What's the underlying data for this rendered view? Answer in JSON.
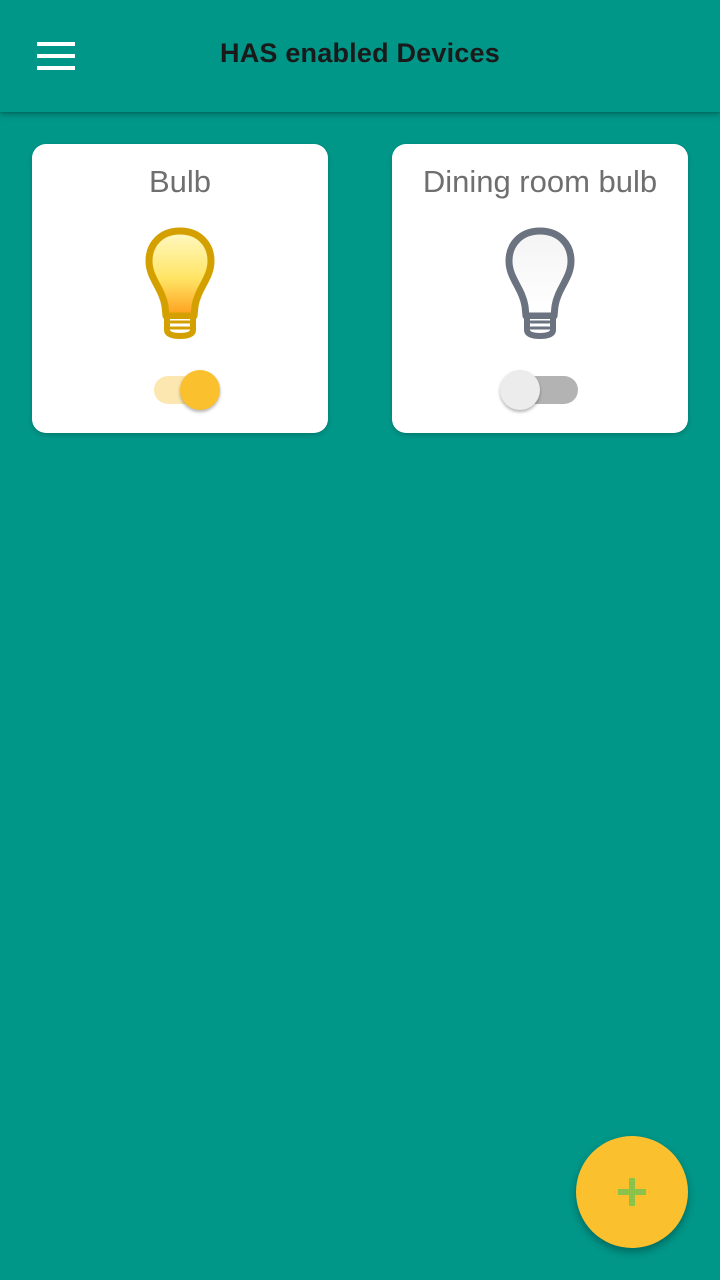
{
  "app_bar": {
    "title": "HAS enabled Devices",
    "menu_icon": "hamburger-menu-icon"
  },
  "devices": [
    {
      "name": "Bulb",
      "icon": "lightbulb-on-icon",
      "state": "on"
    },
    {
      "name": "Dining room bulb",
      "icon": "lightbulb-off-icon",
      "state": "off"
    }
  ],
  "fab": {
    "icon": "plus-icon"
  },
  "colors": {
    "primary": "#009688",
    "accent": "#fbc02d",
    "fab_icon": "#8bc34a",
    "card_title": "#6f6f6f"
  }
}
